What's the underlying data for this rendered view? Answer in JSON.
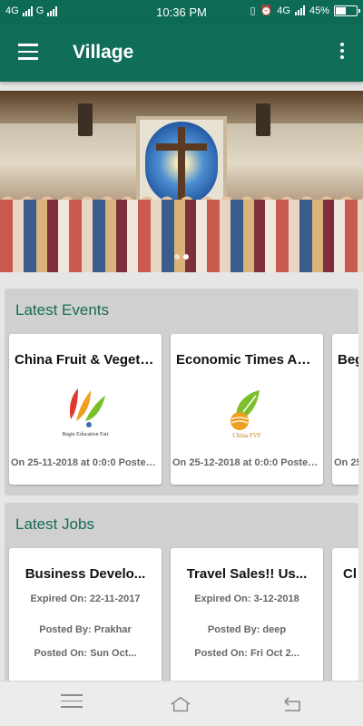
{
  "status_bar": {
    "network_left": "4G",
    "network_mid": "G",
    "time": "10:36 PM",
    "network_right": "4G",
    "battery": "45%",
    "battery_level": 0.45
  },
  "app_bar": {
    "title": "Village",
    "menu_icon": "hamburger-menu-icon",
    "overflow_icon": "more-vert-icon"
  },
  "banner": {
    "slide_count": 2,
    "active_slide": 2
  },
  "events": {
    "title": "Latest Events",
    "cards": [
      {
        "title": "China Fruit & Vegetabl...",
        "logo_caption": "Begin Education Fair",
        "meta": "On 25-11-2018 at 0:0:0 Posted..."
      },
      {
        "title": "Economic Times Acet...",
        "logo_caption": "China FVF",
        "meta": "On 25-12-2018 at 0:0:0 Posted..."
      },
      {
        "title": "Beg",
        "meta": "On 25"
      }
    ]
  },
  "jobs": {
    "title": "Latest Jobs",
    "cards": [
      {
        "title": "Business Develo...",
        "expired": "Expired On: 22-11-2017",
        "posted_by": "Posted By: Prakhar",
        "posted_on": "Posted On: Sun Oct..."
      },
      {
        "title": "Travel Sales!! Us...",
        "expired": "Expired On: 3-12-2018",
        "posted_by": "Posted By: deep",
        "posted_on": "Posted On: Fri Oct 2..."
      },
      {
        "title": "Cl",
        "expired": "",
        "posted_by": "",
        "posted_on": ""
      }
    ]
  }
}
